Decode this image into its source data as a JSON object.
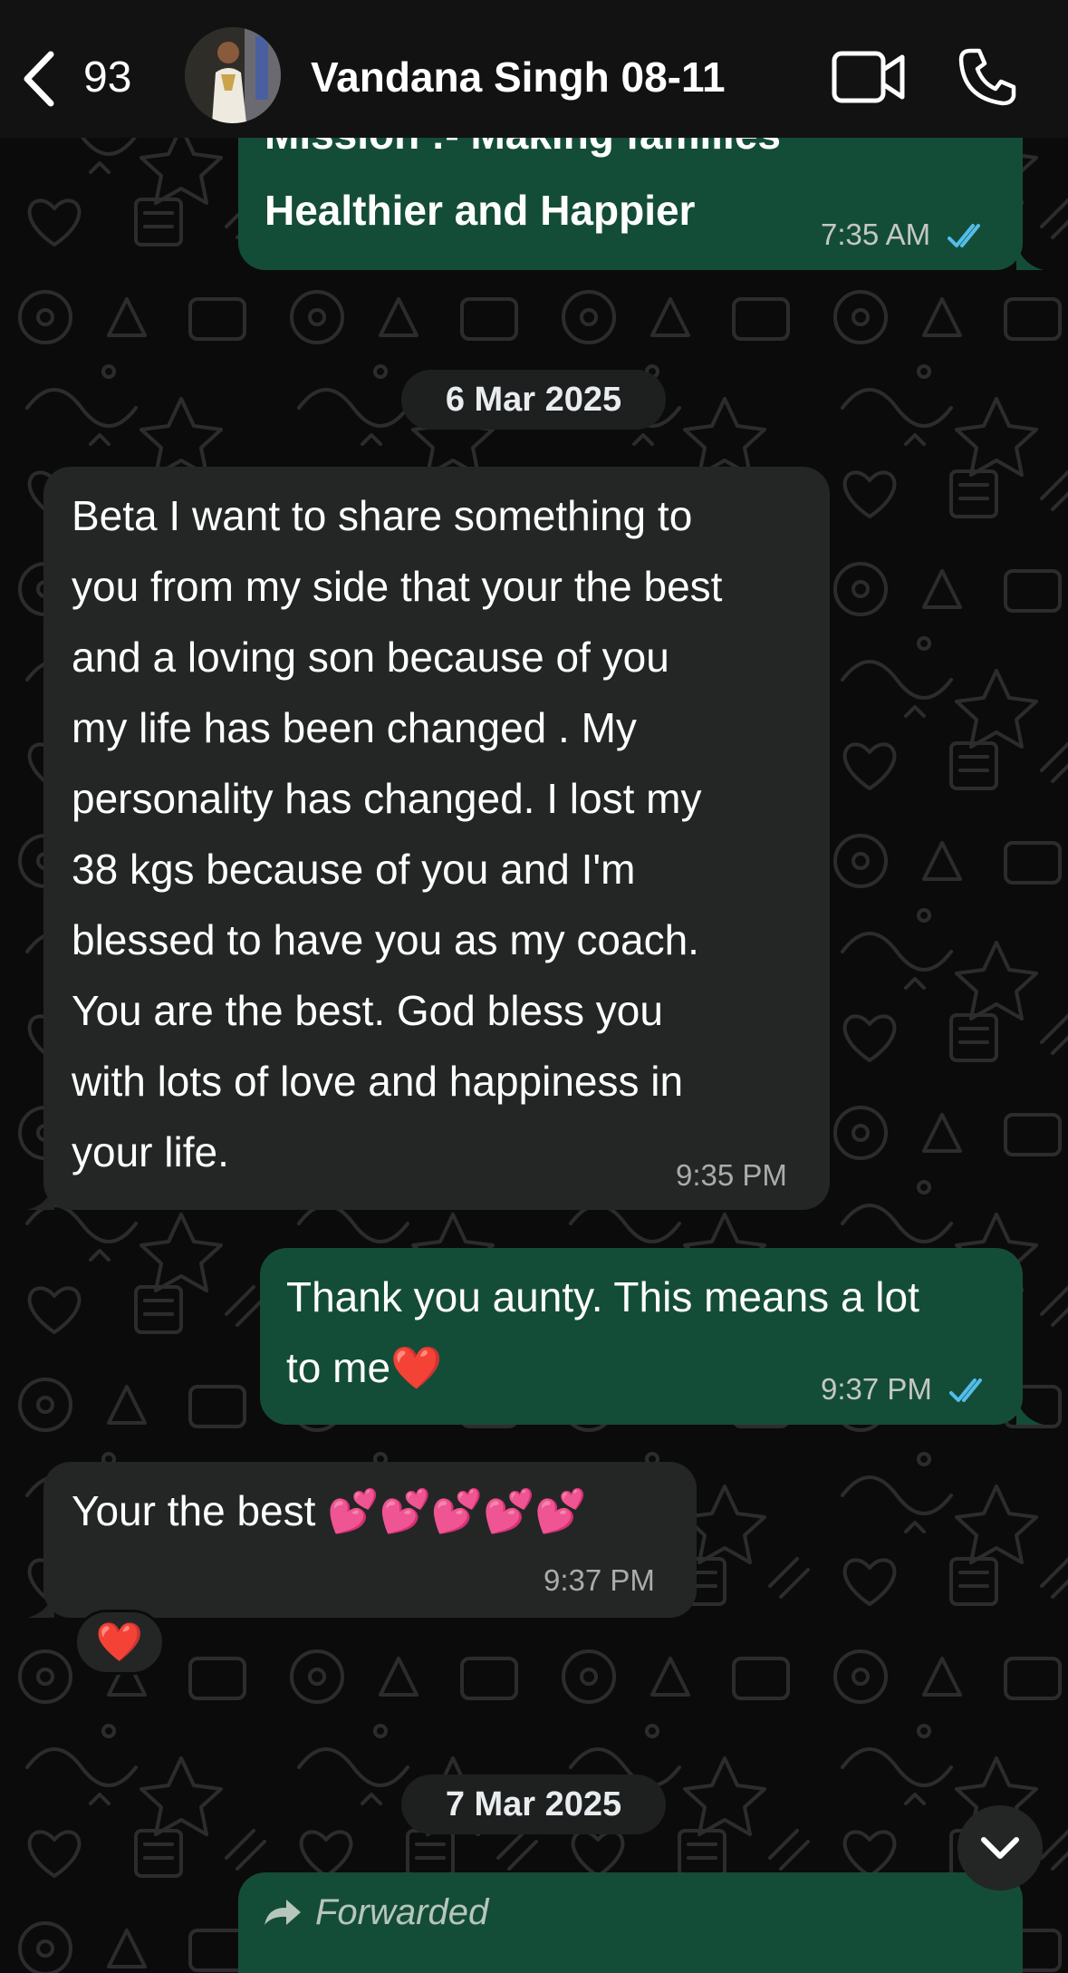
{
  "header": {
    "back_count": "93",
    "contact_name": "Vandana Singh 08-11",
    "icons": [
      "chevron-left-icon",
      "video-camera-icon",
      "phone-icon"
    ]
  },
  "messages": [
    {
      "direction": "outgoing",
      "text_line1": "Mission :- Making families",
      "text_line2": "Healthier and Happier",
      "time": "7:35 AM",
      "read": true
    },
    {
      "direction": "incoming",
      "lines": [
        "Beta I want to share something to",
        "you from my side that your the best",
        "and a loving son because of you",
        "my life has been changed . My",
        "personality has changed. I lost my",
        "38 kgs because of you and I'm",
        "blessed to have you as my coach.",
        "You are the best. God bless you",
        "with lots of love and happiness in",
        "your life."
      ],
      "time": "9:35 PM"
    },
    {
      "direction": "outgoing",
      "line1": "Thank you aunty. This means a lot",
      "line2": "to me❤️",
      "time": "9:37 PM",
      "read": true
    },
    {
      "direction": "incoming",
      "text": "Your the best 💕💕💕💕💕",
      "time": "9:37 PM",
      "reaction": "❤️"
    },
    {
      "direction": "outgoing",
      "forwarded_label": "Forwarded"
    }
  ],
  "date_separators": [
    "6 Mar 2025",
    "7 Mar 2025"
  ],
  "colors": {
    "outgoing_bubble": "#144d37",
    "incoming_bubble": "#242626",
    "read_ticks": "#53bdeb",
    "background": "#0b0b0b"
  }
}
